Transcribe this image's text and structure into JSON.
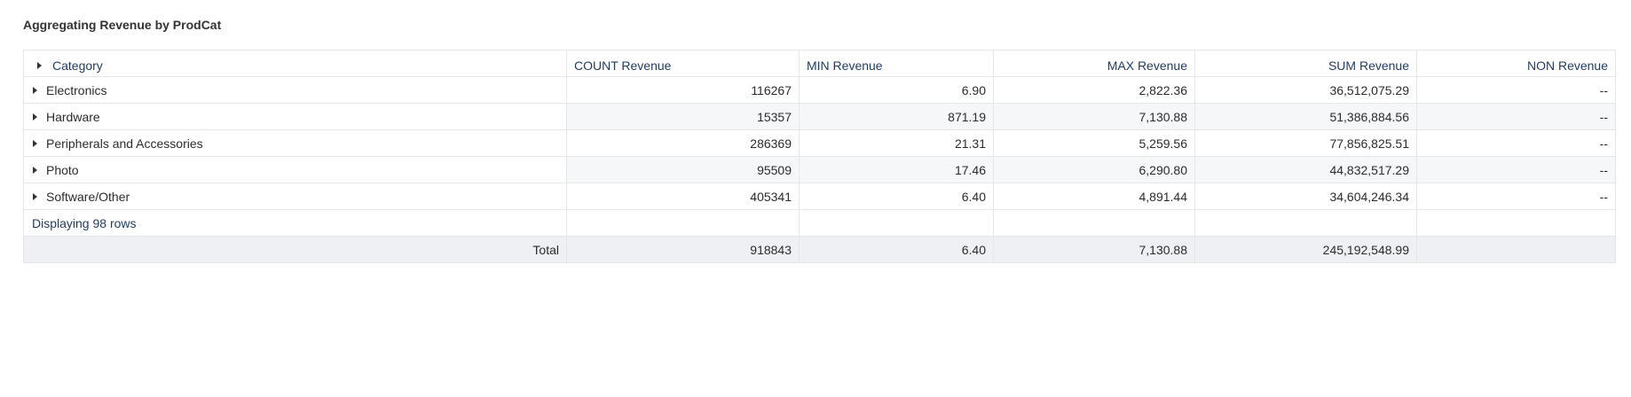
{
  "title": "Aggregating Revenue by ProdCat",
  "columns": {
    "category": "Category",
    "count": "COUNT Revenue",
    "min": "MIN Revenue",
    "max": "MAX Revenue",
    "sum": "SUM Revenue",
    "non": "NON Revenue"
  },
  "rows": [
    {
      "category": "Electronics",
      "count": "116267",
      "min": "6.90",
      "max": "2,822.36",
      "sum": "36,512,075.29",
      "non": "--"
    },
    {
      "category": "Hardware",
      "count": "15357",
      "min": "871.19",
      "max": "7,130.88",
      "sum": "51,386,884.56",
      "non": "--"
    },
    {
      "category": "Peripherals and Accessories",
      "count": "286369",
      "min": "21.31",
      "max": "5,259.56",
      "sum": "77,856,825.51",
      "non": "--"
    },
    {
      "category": "Photo",
      "count": "95509",
      "min": "17.46",
      "max": "6,290.80",
      "sum": "44,832,517.29",
      "non": "--"
    },
    {
      "category": "Software/Other",
      "count": "405341",
      "min": "6.40",
      "max": "4,891.44",
      "sum": "34,604,246.34",
      "non": "--"
    }
  ],
  "footer": {
    "displaying": "Displaying 98 rows"
  },
  "total": {
    "label": "Total",
    "count": "918843",
    "min": "6.40",
    "max": "7,130.88",
    "sum": "245,192,548.99",
    "non": ""
  },
  "colors": {
    "header_text": "#1f3a5f",
    "grid_line": "#e4e6ea",
    "alt_row": "#f6f7f9",
    "total_row": "#eef0f3"
  },
  "icons": {
    "expand": "caret-right-icon"
  }
}
